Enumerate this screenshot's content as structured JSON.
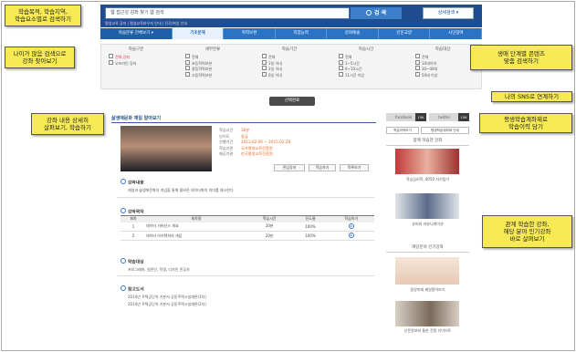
{
  "search": {
    "query": "웹 접근성 강좌 찾기 웹 검색",
    "button": "검 색",
    "advanced": "상세검색 ▾",
    "quick_links": "평생교육 강좌  |  평생교육바우처 안내  |  진로/취업 안내"
  },
  "nav": {
    "first": "학습분류 전체보기 ▾",
    "items": [
      "기초문해",
      "학력보완",
      "직업능력",
      "문화예술",
      "인문교양",
      "시민참여"
    ],
    "selected": 0
  },
  "filters": [
    {
      "title": "학습구분",
      "options": [
        "전체",
        "오프라인 강좌"
      ],
      "on": 0
    },
    {
      "title": "세부분류",
      "options": [
        "전체",
        "초등학력보완",
        "중등학력보완",
        "고등학력보완"
      ],
      "on": -1
    },
    {
      "title": "학습기간",
      "options": [
        "전체",
        "1일 이내",
        "2일 이내",
        "6일 이내"
      ],
      "on": -1
    },
    {
      "title": "학습시간",
      "options": [
        "전체",
        "1~5시간",
        "6~10시간",
        "11시간 이상"
      ],
      "on": -1
    },
    {
      "title": "학습대상",
      "options": [
        "전체",
        "10대이하",
        "20~40대",
        "50대 이상"
      ],
      "on": -1
    }
  ],
  "filter_first_label": "전체 강좌",
  "apply_button": "선택완료",
  "course": {
    "title": "삶생애문화 재일 알아보기",
    "info": [
      {
        "k": "학습시간",
        "v": "30분"
      },
      {
        "k": "난이도",
        "v": "중급"
      },
      {
        "k": "진행기간",
        "v": "2013.02.06 ~ 2015.02.28"
      },
      {
        "k": "학습기관",
        "v": "국가평생교육진흥원"
      },
      {
        "k": "제공기관",
        "v": "한국평생교육진흥원"
      }
    ],
    "buttons": [
      "관심강좌",
      "학습하기",
      "목록보기"
    ]
  },
  "sections": {
    "intro": {
      "title": "강좌내용",
      "text": "재일과 삶생애문화의 개념을 통해 올바른 데이터화의 의미를 제시한다"
    },
    "toc": {
      "title": "강좌목차",
      "headers": [
        "회차",
        "회차명",
        "학습시간",
        "진도율",
        "학습하기"
      ],
      "rows": [
        [
          "1",
          "데이터 거버넌스 개요",
          "20분",
          "100%"
        ],
        [
          "2",
          "데이터 아키텍처의 개념",
          "20분",
          "100%"
        ]
      ]
    },
    "target": {
      "title": "학습대상",
      "text": "프로그래머, 일반인, 학생, 디자인 전공자"
    },
    "ref": {
      "title": "참고도서",
      "lines": [
        "2014년 주택공단자 기본서 공동주택시설개론(1차)",
        "2014년 주택공단자 기본서 공동주택시설개론(2차)"
      ]
    }
  },
  "side": {
    "sns": [
      {
        "label": "facebook",
        "count": "15K"
      },
      {
        "label": "twitter",
        "count": "15K"
      }
    ],
    "tabs": [
      "학습이력보기",
      "평생학습계좌제 안내"
    ],
    "related_title": "함께 학습한 강좌",
    "related": [
      "학습심리학, 4050 자기탐기",
      "유머와 커뮤니케이션"
    ],
    "popular_title": "해당분야 인기강좌",
    "popular": [
      "동양미래 제일알아보기",
      "신문정보와 통한 전정 다이어트"
    ]
  },
  "notes": [
    "학습목적, 학습지역,\n학습요소별로 검색하기",
    "나이가 많음 검색으로\n강좌 찾아보기",
    "생애 단계별 콘텐츠\n맞춤 검색하기",
    "나의 SNS로 연계하기",
    "평생학습계좌제로\n학습이력 담기",
    "강좌 내용 상세히\n살펴보기, 학습하기",
    "관계 학습한 강좌,\n해당 분야 인기강좌\n바로 살펴보기"
  ],
  "colors": {
    "nav": "#2a74c7",
    "top": "#1f4d8f",
    "accent": "#e36a1b",
    "note": "#f7ea55"
  }
}
